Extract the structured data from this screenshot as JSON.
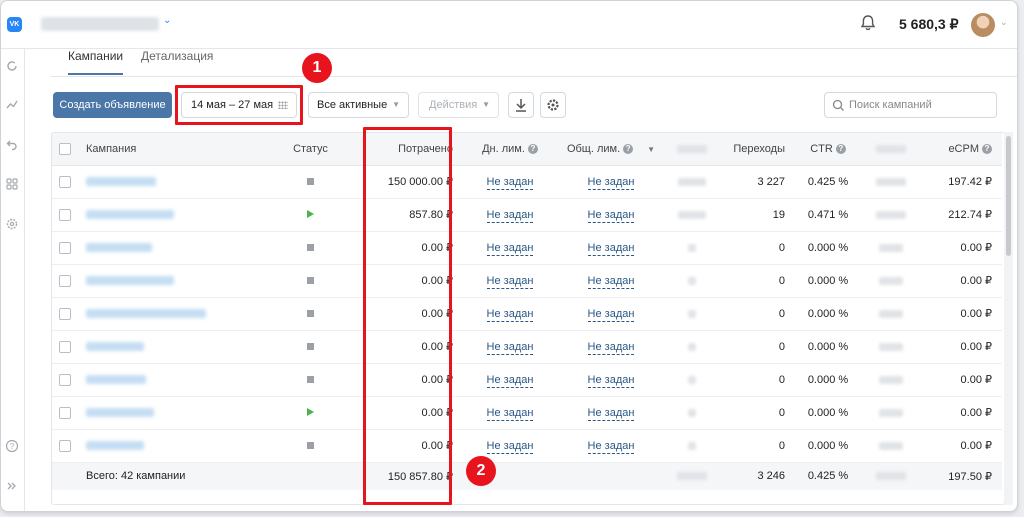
{
  "header": {
    "logo": "VK",
    "balance": "5 680,3 ₽"
  },
  "tabs": [
    {
      "label": "Кампании",
      "active": true
    },
    {
      "label": "Детализация",
      "active": false
    }
  ],
  "toolbar": {
    "create_label": "Создать объявление",
    "date_range": "14 мая – 27 мая",
    "filter_label": "Все активные",
    "actions_label": "Действия",
    "search_placeholder": "Поиск кампаний"
  },
  "table": {
    "columns": [
      "Кампания",
      "Статус",
      "Потрачено",
      "Дн. лим.",
      "Общ. лим.",
      "Переходы",
      "CTR",
      "eCPM"
    ],
    "rows": [
      {
        "status": "stopped",
        "spent": "150 000.00 ₽",
        "day_limit": "Не задан",
        "total_limit": "Не задан",
        "clicks": "3 227",
        "ctr": "0.425 %",
        "ecpm": "197.42 ₽"
      },
      {
        "status": "active",
        "spent": "857.80 ₽",
        "day_limit": "Не задан",
        "total_limit": "Не задан",
        "clicks": "19",
        "ctr": "0.471 %",
        "ecpm": "212.74 ₽"
      },
      {
        "status": "stopped",
        "spent": "0.00 ₽",
        "day_limit": "Не задан",
        "total_limit": "Не задан",
        "clicks": "0",
        "ctr": "0.000 %",
        "ecpm": "0.00 ₽"
      },
      {
        "status": "stopped",
        "spent": "0.00 ₽",
        "day_limit": "Не задан",
        "total_limit": "Не задан",
        "clicks": "0",
        "ctr": "0.000 %",
        "ecpm": "0.00 ₽"
      },
      {
        "status": "stopped",
        "spent": "0.00 ₽",
        "day_limit": "Не задан",
        "total_limit": "Не задан",
        "clicks": "0",
        "ctr": "0.000 %",
        "ecpm": "0.00 ₽"
      },
      {
        "status": "stopped",
        "spent": "0.00 ₽",
        "day_limit": "Не задан",
        "total_limit": "Не задан",
        "clicks": "0",
        "ctr": "0.000 %",
        "ecpm": "0.00 ₽"
      },
      {
        "status": "stopped",
        "spent": "0.00 ₽",
        "day_limit": "Не задан",
        "total_limit": "Не задан",
        "clicks": "0",
        "ctr": "0.000 %",
        "ecpm": "0.00 ₽"
      },
      {
        "status": "active",
        "spent": "0.00 ₽",
        "day_limit": "Не задан",
        "total_limit": "Не задан",
        "clicks": "0",
        "ctr": "0.000 %",
        "ecpm": "0.00 ₽"
      },
      {
        "status": "stopped",
        "spent": "0.00 ₽",
        "day_limit": "Не задан",
        "total_limit": "Не задан",
        "clicks": "0",
        "ctr": "0.000 %",
        "ecpm": "0.00 ₽"
      }
    ],
    "footer": {
      "total_label": "Всего: 42 кампании",
      "spent": "150 857.80 ₽",
      "clicks": "3 246",
      "ctr": "0.425 %",
      "ecpm": "197.50 ₽"
    }
  },
  "callouts": [
    {
      "number": "1"
    },
    {
      "number": "2"
    }
  ],
  "colors": {
    "primary": "#4a76a8",
    "highlight": "#e8141d",
    "active_status": "#4bb34b",
    "stopped_status": "#9aa0a6",
    "link": "#2a5885"
  }
}
